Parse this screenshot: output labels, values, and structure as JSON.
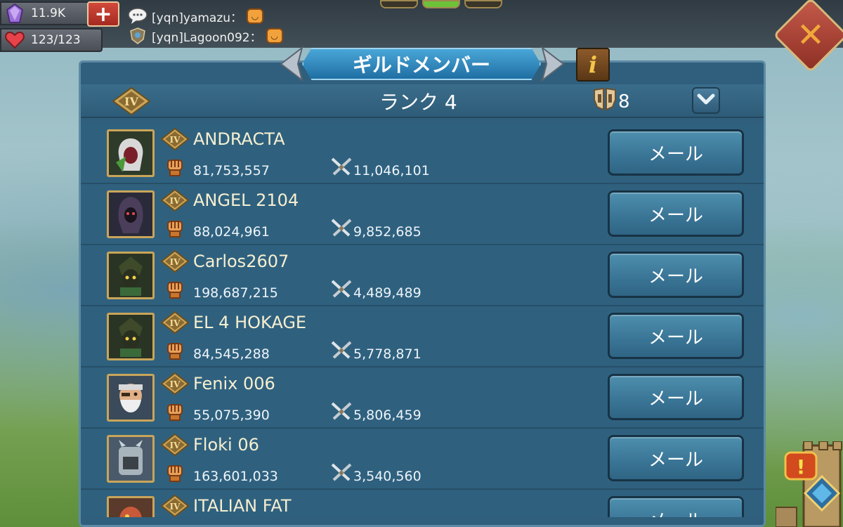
{
  "resources": {
    "gems": "11.9K",
    "stamina": "123/123"
  },
  "chat": [
    {
      "text": "[yqn]yamazu："
    },
    {
      "text": "[yqn]Lagoon092："
    }
  ],
  "panel": {
    "title": "ギルドメンバー",
    "info_label": "i",
    "rank_badge": "IV",
    "rank_title": "ランク 4",
    "member_count": "8"
  },
  "members": [
    {
      "rank": "IV",
      "name": "ANDRACTA",
      "might": "81,753,557",
      "kills": "11,046,101",
      "mail": "メール"
    },
    {
      "rank": "IV",
      "name": "ANGEL 2104",
      "might": "88,024,961",
      "kills": "9,852,685",
      "mail": "メール"
    },
    {
      "rank": "IV",
      "name": "Carlos2607",
      "might": "198,687,215",
      "kills": "4,489,489",
      "mail": "メール"
    },
    {
      "rank": "IV",
      "name": "EL 4 HOKAGE",
      "might": "84,545,288",
      "kills": "5,778,871",
      "mail": "メール"
    },
    {
      "rank": "IV",
      "name": "Fenix 006",
      "might": "55,075,390",
      "kills": "5,806,459",
      "mail": "メール"
    },
    {
      "rank": "IV",
      "name": "Floki 06",
      "might": "163,601,033",
      "kills": "3,540,560",
      "mail": "メール"
    },
    {
      "rank": "IV",
      "name": "ITALIAN FAT",
      "might": "",
      "kills": "",
      "mail": "メール"
    }
  ],
  "colors": {
    "panel": "#2f5f7c",
    "mail_button": "#3b7697",
    "rank_gold": "#c9a55a",
    "title_blue": "#1f6fa3"
  },
  "icons": {
    "gem": "purple-gem-icon",
    "stamina": "heart-icon",
    "close": "close-x-icon",
    "might": "fist-icon",
    "kills": "crossed-swords-icon",
    "members": "helmet-icon",
    "dropdown": "chevron-down-icon"
  }
}
